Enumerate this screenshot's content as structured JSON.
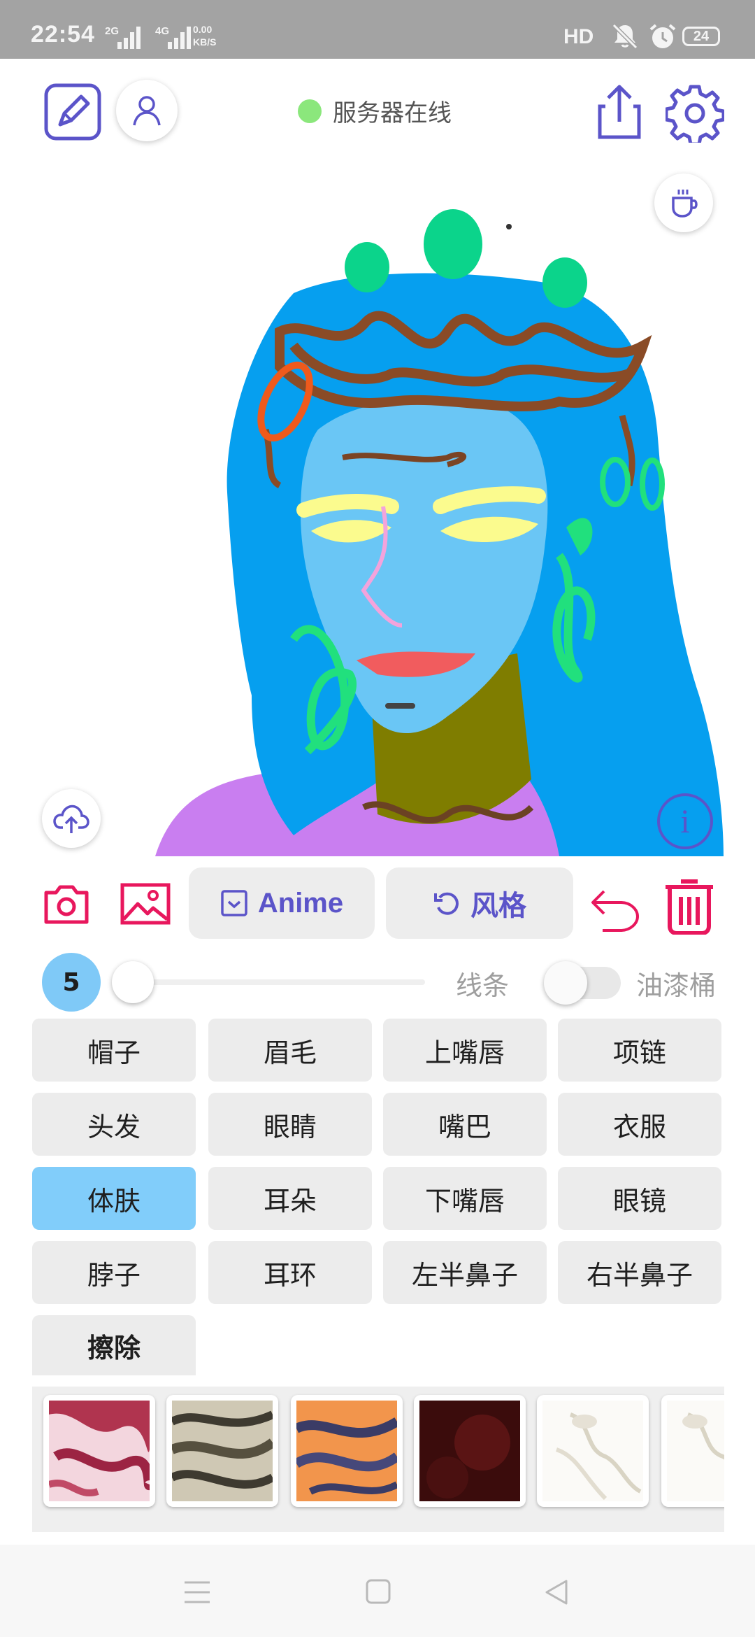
{
  "status_bar": {
    "time": "22:54",
    "sim1_network": "2G",
    "sim2_network": "4G",
    "speed_value": "0.00",
    "speed_unit": "KB/S",
    "hd_label": "HD",
    "battery_level": "24",
    "icons": [
      "signal-icon",
      "signal-icon",
      "mute-icon",
      "alarm-icon",
      "battery-icon"
    ]
  },
  "topbar": {
    "left_icons": [
      "edit-icon",
      "user-icon"
    ],
    "server_status": "服务器在线",
    "server_status_color": "#8be77c",
    "right_icons": [
      "share-icon",
      "settings-icon"
    ]
  },
  "canvas": {
    "overlay_icons": [
      "coffee-cup-icon",
      "upload-cloud-icon",
      "info-icon"
    ]
  },
  "toolbar": {
    "camera_icon": "camera-icon",
    "gallery_icon": "image-icon",
    "anime_label": "Anime",
    "style_label": "风格",
    "undo_icon": "undo-icon",
    "delete_icon": "trash-icon"
  },
  "brush": {
    "size": "5",
    "size_fraction": 0.0,
    "lines_label": "线条",
    "bucket_label": "油漆桶",
    "bucket_enabled": false
  },
  "labels": {
    "rows": [
      [
        "帽子",
        "眉毛",
        "上嘴唇",
        "项链"
      ],
      [
        "头发",
        "眼睛",
        "嘴巴",
        "衣服"
      ],
      [
        "体肤",
        "耳朵",
        "下嘴唇",
        "眼镜"
      ],
      [
        "脖子",
        "耳环",
        "左半鼻子",
        "右半鼻子"
      ]
    ],
    "selected": "体肤",
    "erase_label": "擦除"
  },
  "colors": {
    "accent": "#5b54c9",
    "danger": "#e8175d",
    "selected_label": "#81cdfa",
    "brush_bubble": "#7fc9f7"
  },
  "styles_strip": {
    "count_visible": 6
  }
}
